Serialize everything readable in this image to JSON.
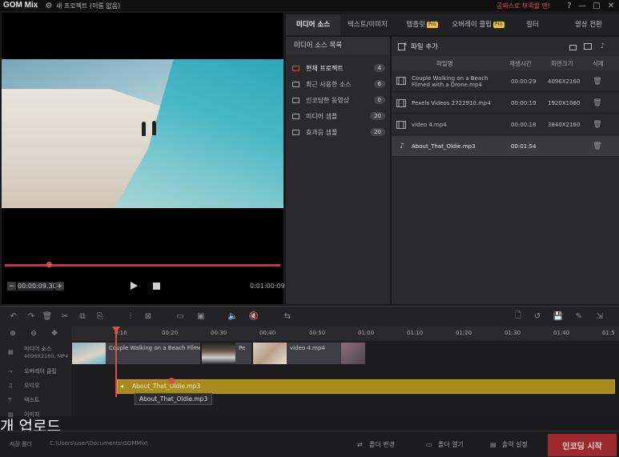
{
  "titlebar": {
    "logo": "GOM Mix",
    "project_title": "새 프로젝트 (이름 없음)",
    "promo": "공짜스로 부족할 땐!",
    "window_buttons": [
      "?",
      "—",
      "□",
      "✕"
    ]
  },
  "player": {
    "progress_fraction": 0.16,
    "current_time": "00:00:09.30",
    "end_time": "0:01:00:09"
  },
  "tabs": [
    {
      "label": "미디어 소스",
      "active": true
    },
    {
      "label": "텍스트/이미지",
      "active": false
    },
    {
      "label": "템플릿",
      "pro": "Pro",
      "active": false
    },
    {
      "label": "오버레이 클립",
      "pro": "Pro",
      "active": false
    },
    {
      "label": "필터",
      "active": false
    },
    {
      "label": "영상 전환",
      "active": false
    }
  ],
  "source_panel": {
    "heading": "미디어 소스 목록",
    "items": [
      {
        "label": "현재 프로젝트",
        "count": "4"
      },
      {
        "label": "최근 사용한 소스",
        "count": "6"
      },
      {
        "label": "인코딩한 동영상",
        "count": "0"
      },
      {
        "label": "미디어 샘플",
        "count": "20"
      },
      {
        "label": "효과음 샘플",
        "count": "20"
      }
    ]
  },
  "file_panel": {
    "add_file": "파일 추가",
    "columns": [
      "파일명",
      "재생시간",
      "화면크기",
      "삭제"
    ],
    "rows": [
      {
        "name": "Couple Walking on a Beach Filmed with a Drone.mp4",
        "duration": "00:00:29",
        "size": "4096X2160",
        "type": "video"
      },
      {
        "name": "Pexels Videos 2722910.mp4",
        "duration": "00:00:10",
        "size": "1920X1080",
        "type": "video"
      },
      {
        "name": "video 4.mp4",
        "duration": "00:00:18",
        "size": "3840X2160",
        "type": "video"
      },
      {
        "name": "About_That_Oldie.mp3",
        "duration": "00:01:54",
        "size": "",
        "type": "audio"
      }
    ]
  },
  "timeline": {
    "ticks": [
      "0:10",
      "00:20",
      "00:30",
      "00:40",
      "00:50",
      "01:00",
      "01:10",
      "01:20",
      "01:30",
      "01:40",
      "01:5"
    ],
    "tracks": [
      {
        "label": "미디어 소스",
        "sub": "4096X2160, MP4"
      },
      {
        "label": "오버레이 클립",
        "sub": ""
      },
      {
        "label": "오디오",
        "sub": ""
      },
      {
        "label": "텍스트",
        "sub": ""
      },
      {
        "label": "이미지",
        "sub": ""
      }
    ],
    "clips": [
      "Couple Walking on a Beach Filmed",
      "Pe",
      "video 4.mp4"
    ],
    "audio_clip": "About_That_Oldie.mp3",
    "tooltip": "About_That_Oldie.mp3"
  },
  "overlay_caption": "개 업로드",
  "statusbar": {
    "save_folder_label": "저장 폴더",
    "save_path": "C:\\Users\\user\\Documents\\GOMMix\\",
    "change_folder": "폴더 변경",
    "open_folder": "폴더 열기",
    "output_settings": "출력 설정",
    "encode_start": "인코딩 시작"
  },
  "colors": {
    "accent_red": "#e04b4e",
    "audio_gold": "#a88a1e",
    "encode_button": "#9c2a2d"
  }
}
